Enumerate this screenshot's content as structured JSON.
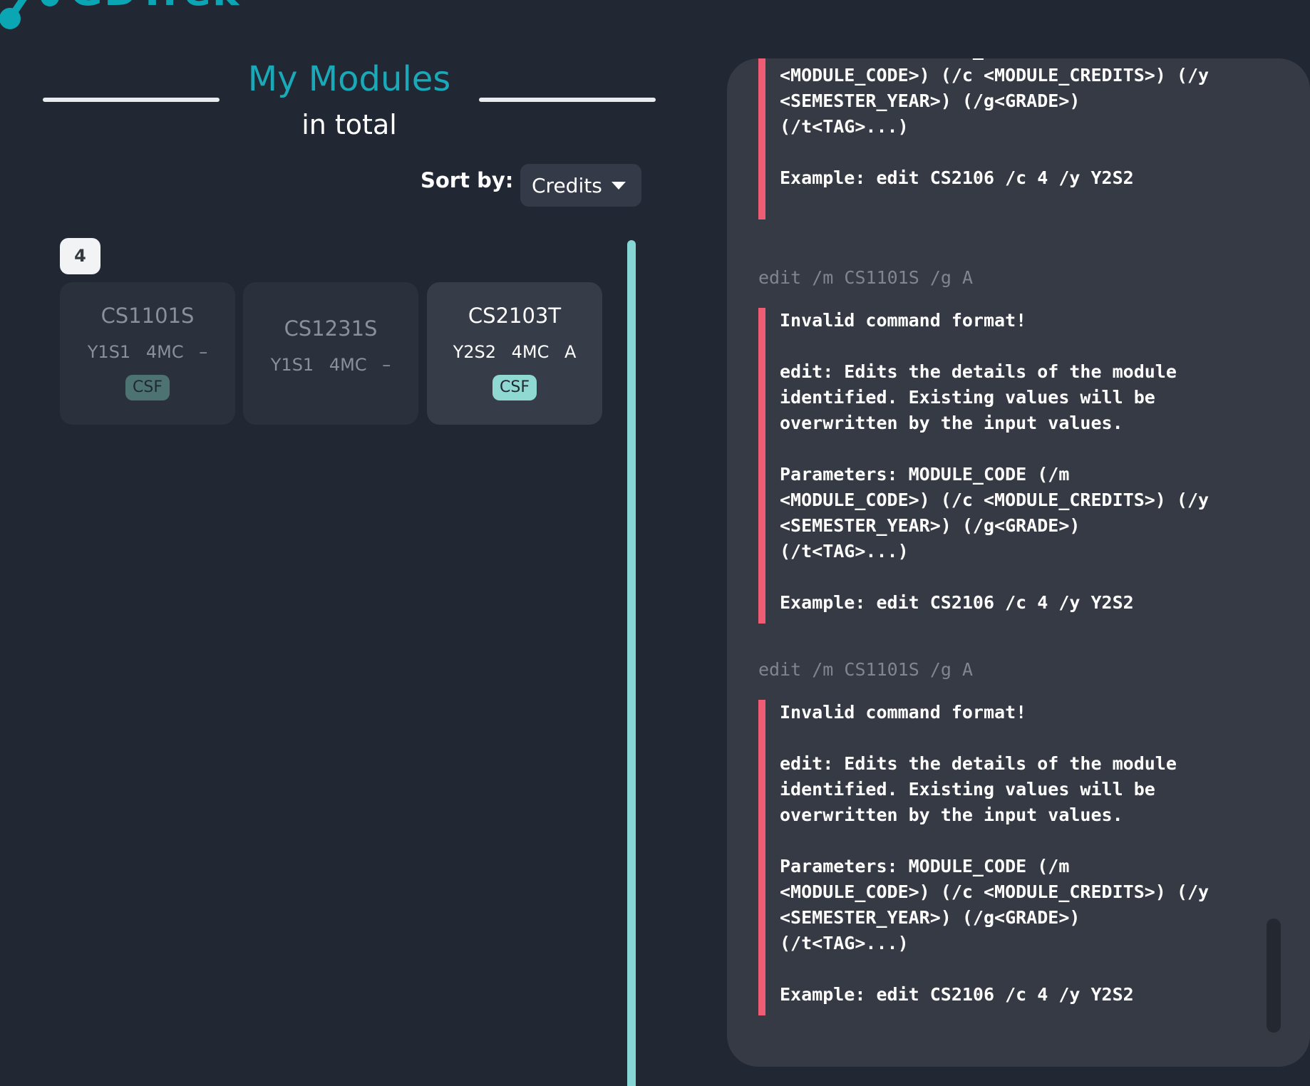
{
  "app": {
    "logo_text": "GDTrek"
  },
  "header": {
    "title": "My Modules",
    "subtitle": "in total"
  },
  "sort": {
    "label": "Sort by:",
    "selected": "Credits"
  },
  "group": {
    "count": "4"
  },
  "modules": [
    {
      "code": "CS1101S",
      "semester": "Y1S1",
      "credits": "4MC",
      "grade": "–",
      "tag": "CSF",
      "state": "dim"
    },
    {
      "code": "CS1231S",
      "semester": "Y1S1",
      "credits": "4MC",
      "grade": "–",
      "tag": "",
      "state": "dim"
    },
    {
      "code": "CS2103T",
      "semester": "Y2S2",
      "credits": "4MC",
      "grade": "A",
      "tag": "CSF",
      "state": "active"
    }
  ],
  "log": {
    "partial_top": "Parameters: MODULE_CODE (/m\n<MODULE_CODE>) (/c <MODULE_CREDITS>) (/y\n<SEMESTER_YEAR>) (/g<GRADE>)\n(/t<TAG>...)\n\nExample: edit CS2106 /c 4 /y Y2S2",
    "entries": [
      {
        "command": "edit /m CS1101S /g A",
        "result": "Invalid command format!\n\nedit: Edits the details of the module\nidentified. Existing values will be\noverwritten by the input values.\n\nParameters: MODULE_CODE (/m\n<MODULE_CODE>) (/c <MODULE_CREDITS>) (/y\n<SEMESTER_YEAR>) (/g<GRADE>)\n(/t<TAG>...)\n\nExample: edit CS2106 /c 4 /y Y2S2"
      },
      {
        "command": "edit /m CS1101S /g A",
        "result": "Invalid command format!\n\nedit: Edits the details of the module\nidentified. Existing values will be\noverwritten by the input values.\n\nParameters: MODULE_CODE (/m\n<MODULE_CODE>) (/c <MODULE_CREDITS>) (/y\n<SEMESTER_YEAR>) (/g<GRADE>)\n(/t<TAG>...)\n\nExample: edit CS2106 /c 4 /y Y2S2"
      }
    ]
  },
  "colors": {
    "accent": "#1aa9b8",
    "error_bar": "#ee5d74",
    "divider": "#86d6d6"
  }
}
